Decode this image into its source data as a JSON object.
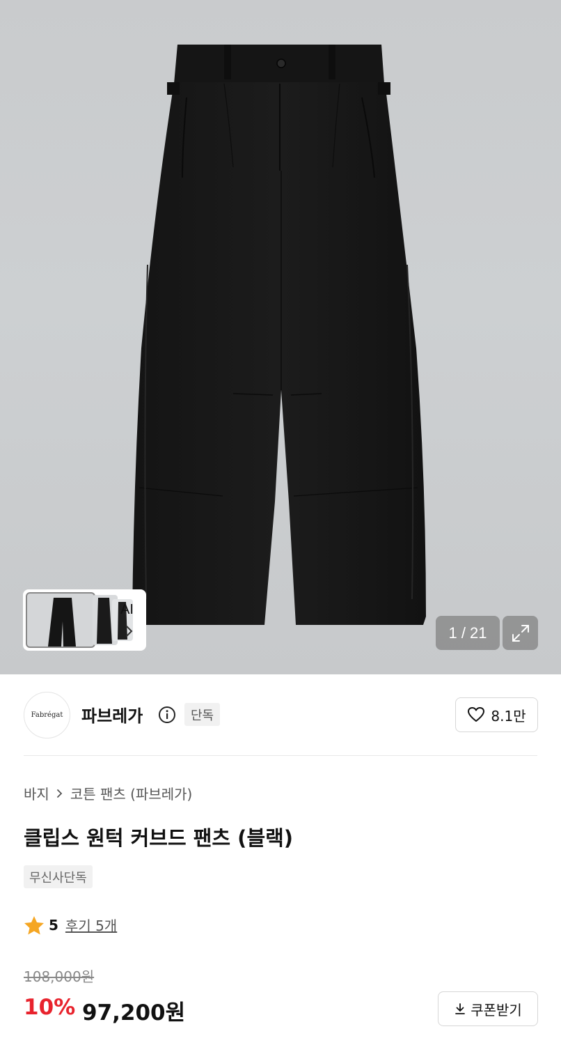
{
  "gallery": {
    "counter": "1 / 21",
    "ai_label": "AI",
    "icons": {
      "expand": "expand-icon",
      "chevron": "chevron-right-icon"
    }
  },
  "brand": {
    "logo_text": "Fabrégat",
    "name": "파브레가",
    "badge": "단독",
    "likes": "8.1만",
    "icons": {
      "info": "info-icon",
      "like": "heart-icon"
    }
  },
  "breadcrumb": {
    "category": "바지",
    "subcategory": "코튼 팬츠 (파브레가)"
  },
  "product": {
    "title": "클립스 원턱 커브드 팬츠 (블랙)",
    "tag": "무신사단독"
  },
  "rating": {
    "score": "5",
    "reviews_label": "후기 5개",
    "star_color": "#f5a623"
  },
  "price": {
    "original": "108,000원",
    "discount": "10%",
    "final": "97,200원",
    "discount_color": "#e8232d"
  },
  "coupon": {
    "label": "쿠폰받기",
    "icon": "download-icon"
  }
}
